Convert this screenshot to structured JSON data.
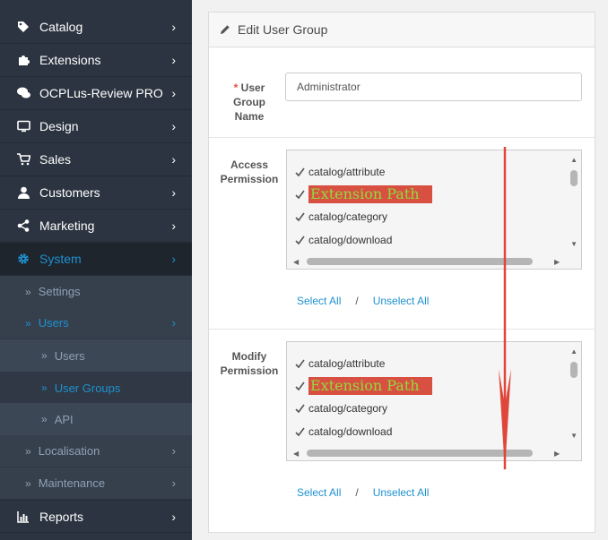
{
  "sidebar": {
    "menu": [
      {
        "label": "Catalog",
        "icon": "tag-icon"
      },
      {
        "label": "Extensions",
        "icon": "puzzle-icon"
      },
      {
        "label": "OCPLus-Review PRO",
        "icon": "comments-icon"
      },
      {
        "label": "Design",
        "icon": "monitor-icon"
      },
      {
        "label": "Sales",
        "icon": "cart-icon"
      },
      {
        "label": "Customers",
        "icon": "user-icon"
      },
      {
        "label": "Marketing",
        "icon": "share-icon"
      },
      {
        "label": "System",
        "icon": "gear-icon"
      }
    ],
    "system_sub": [
      {
        "label": "Settings"
      },
      {
        "label": "Users"
      }
    ],
    "users_sub": [
      {
        "label": "Users"
      },
      {
        "label": "User Groups"
      },
      {
        "label": "API"
      }
    ],
    "system_sub_after": [
      {
        "label": "Localisation"
      },
      {
        "label": "Maintenance"
      }
    ],
    "reports": {
      "label": "Reports",
      "icon": "bar-chart-icon"
    }
  },
  "panel": {
    "title": "Edit User Group",
    "group_name": {
      "required_mark": "*",
      "label_l1": "User",
      "label_l2": "Group",
      "label_l3": "Name",
      "value": "Administrator"
    },
    "access": {
      "label_l1": "Access",
      "label_l2": "Permission",
      "items": [
        "catalog/attribute",
        "Extension Path",
        "catalog/category",
        "catalog/download"
      ]
    },
    "modify": {
      "label_l1": "Modify",
      "label_l2": "Permission",
      "items": [
        "catalog/attribute",
        "Extension Path",
        "catalog/category",
        "catalog/download"
      ]
    },
    "select_all": "Select All",
    "separator": "/",
    "unselect_all": "Unselect All"
  },
  "colors": {
    "sidebar_bg": "#2b3440",
    "accent": "#1e91cf",
    "highlight_bg": "#d85041",
    "highlight_text": "#8fdc3c",
    "annotation_arrow": "#e0473b"
  }
}
